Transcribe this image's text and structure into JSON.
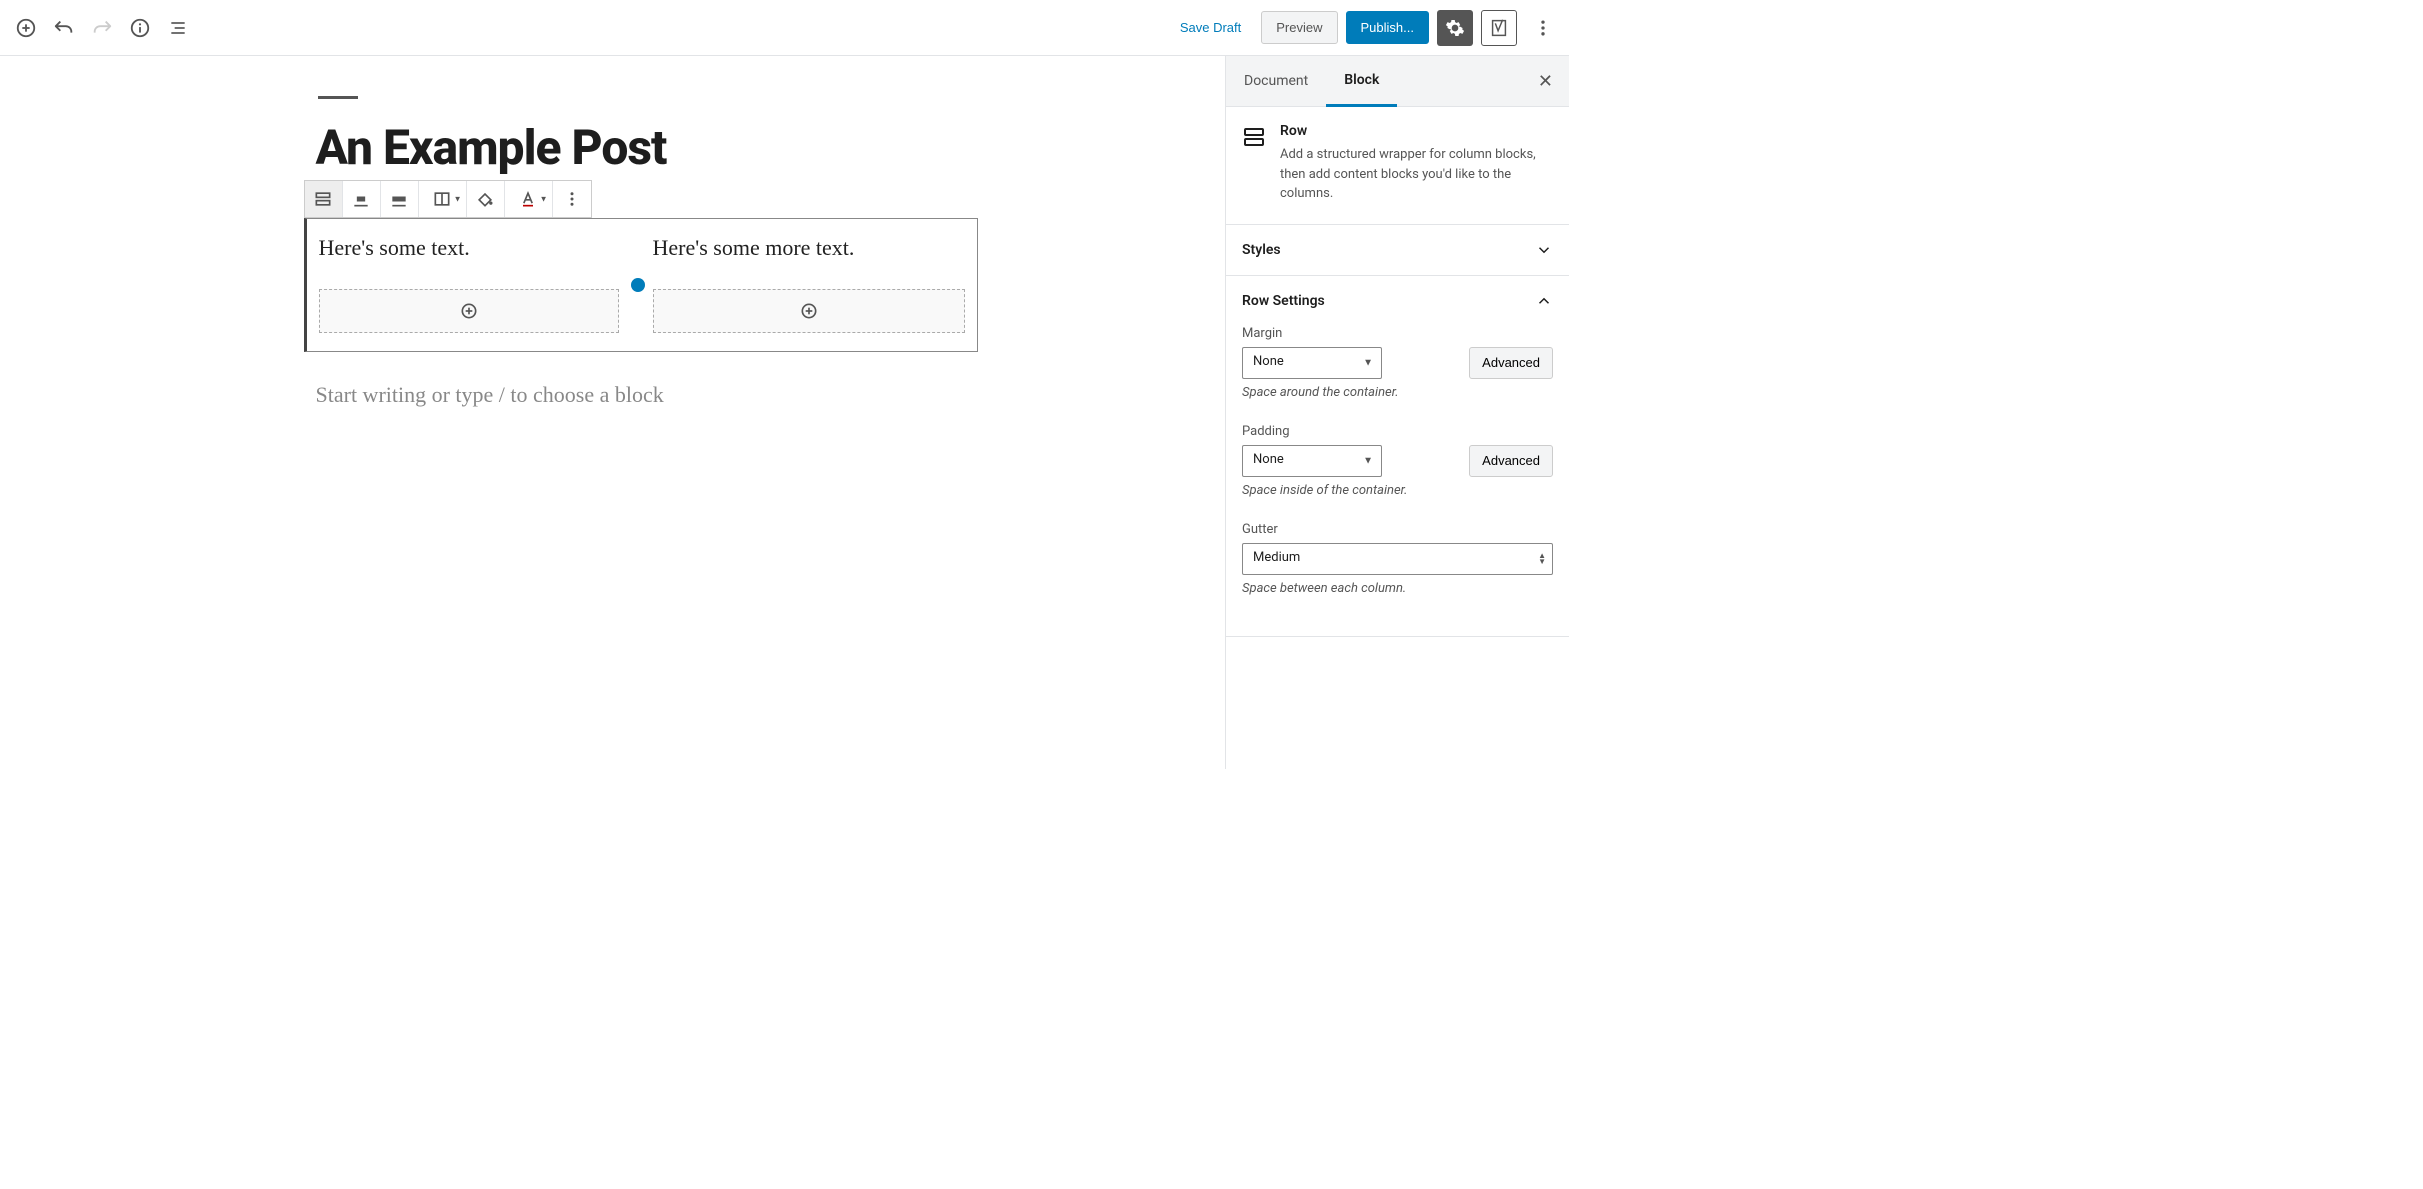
{
  "toolbar": {
    "save_draft": "Save Draft",
    "preview": "Preview",
    "publish": "Publish..."
  },
  "post": {
    "title": "An Example Post",
    "columns": [
      {
        "text": "Here's some text."
      },
      {
        "text": "Here's some more text."
      }
    ],
    "placeholder": "Start writing or type / to choose a block"
  },
  "sidebar": {
    "tabs": {
      "document": "Document",
      "block": "Block"
    },
    "block": {
      "name": "Row",
      "description": "Add a structured wrapper for column blocks, then add content blocks you'd like to the columns."
    },
    "panels": {
      "styles": "Styles",
      "row_settings": "Row Settings"
    },
    "row_settings": {
      "margin": {
        "label": "Margin",
        "value": "None",
        "advanced": "Advanced",
        "help": "Space around the container."
      },
      "padding": {
        "label": "Padding",
        "value": "None",
        "advanced": "Advanced",
        "help": "Space inside of the container."
      },
      "gutter": {
        "label": "Gutter",
        "value": "Medium",
        "help": "Space between each column."
      }
    }
  }
}
